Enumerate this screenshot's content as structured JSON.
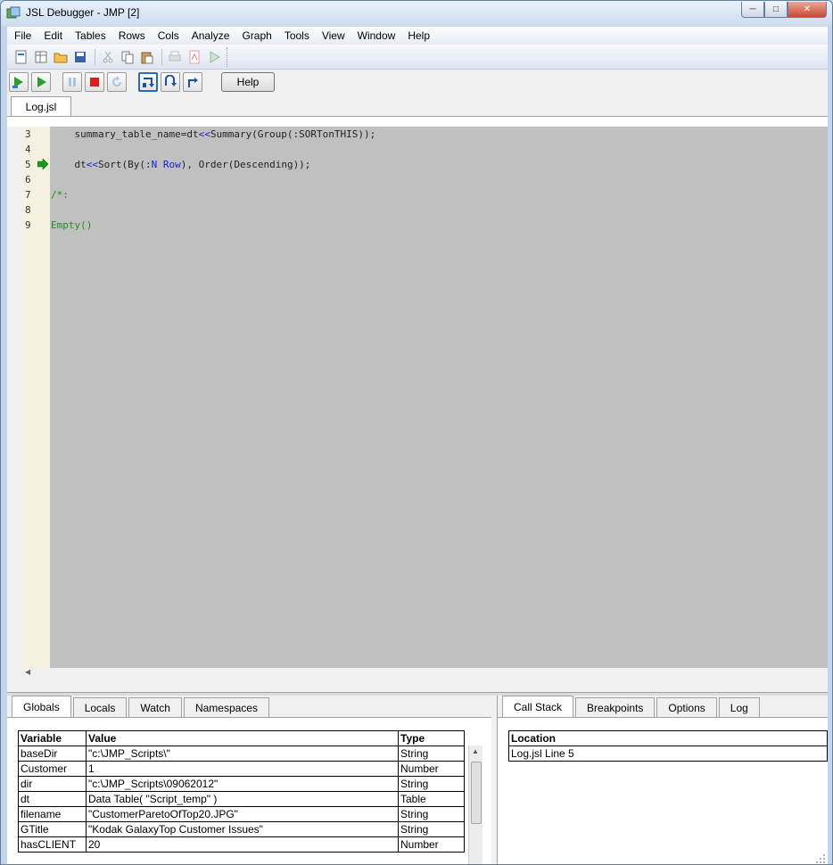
{
  "window": {
    "title": "JSL Debugger - JMP [2]"
  },
  "menu": [
    "File",
    "Edit",
    "Tables",
    "Rows",
    "Cols",
    "Analyze",
    "Graph",
    "Tools",
    "View",
    "Window",
    "Help"
  ],
  "debug_toolbar": {
    "help_label": "Help"
  },
  "file_tab": {
    "label": "Log.jsl"
  },
  "editor": {
    "lines": [
      {
        "num": "3",
        "parts": [
          {
            "t": "    summary_table_name=dt",
            "c": ""
          },
          {
            "t": "<<",
            "c": "blue"
          },
          {
            "t": "Summary(Group(:SORTonTHIS));",
            "c": ""
          }
        ]
      },
      {
        "num": "4",
        "parts": []
      },
      {
        "num": "5",
        "parts": [
          {
            "t": "    dt",
            "c": ""
          },
          {
            "t": "<<",
            "c": "blue"
          },
          {
            "t": "Sort(By(:",
            "c": ""
          },
          {
            "t": "N Row",
            "c": "blue"
          },
          {
            "t": "), Order(Descending));",
            "c": ""
          }
        ]
      },
      {
        "num": "6",
        "parts": []
      },
      {
        "num": "7",
        "parts": [
          {
            "t": "/*:",
            "c": "green"
          }
        ]
      },
      {
        "num": "8",
        "parts": []
      },
      {
        "num": "9",
        "parts": [
          {
            "t": "Empty()",
            "c": "green"
          }
        ]
      }
    ],
    "current_line": "5"
  },
  "left_tabs": [
    "Globals",
    "Locals",
    "Watch",
    "Namespaces"
  ],
  "right_tabs": [
    "Call Stack",
    "Breakpoints",
    "Options",
    "Log"
  ],
  "globals": {
    "headers": [
      "Variable",
      "Value",
      "Type"
    ],
    "rows": [
      [
        "baseDir",
        "\"c:\\JMP_Scripts\\\"",
        "String"
      ],
      [
        "Customer",
        "1",
        "Number"
      ],
      [
        "dir",
        "\"c:\\JMP_Scripts\\09062012\"",
        "String"
      ],
      [
        "dt",
        "Data Table( \"Script_temp\" )",
        "Table"
      ],
      [
        "filename",
        "\"CustomerParetoOfTop20.JPG\"",
        "String"
      ],
      [
        "GTitle",
        "\"Kodak GalaxyTop Customer Issues\"",
        "String"
      ],
      [
        "hasCLIENT",
        "20",
        "Number"
      ]
    ]
  },
  "callstack": {
    "header": "Location",
    "rows": [
      "Log.jsl Line 5"
    ]
  },
  "colors": {
    "editor_bg": "#c0c0c0",
    "gutter_bg": "#f4f1e0",
    "keyword_blue": "#1a1ad6",
    "comment_green": "#1f8c1f"
  }
}
